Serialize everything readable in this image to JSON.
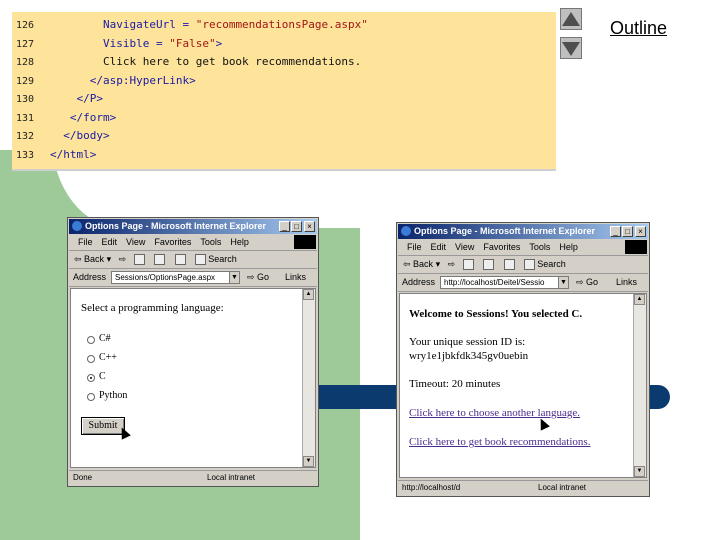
{
  "code": {
    "lines": [
      {
        "n": "126",
        "indent": "        ",
        "parts": [
          {
            "c": "kw",
            "t": "NavigateUrl = "
          },
          {
            "c": "str",
            "t": "\"recommendationsPage.aspx\""
          }
        ]
      },
      {
        "n": "127",
        "indent": "        ",
        "parts": [
          {
            "c": "kw",
            "t": "Visible = "
          },
          {
            "c": "str",
            "t": "\"False\""
          },
          {
            "c": "kw",
            "t": ">"
          }
        ]
      },
      {
        "n": "128",
        "indent": "        ",
        "parts": [
          {
            "c": "tx",
            "t": "Click here to get book recommendations."
          }
        ]
      },
      {
        "n": "129",
        "indent": "      ",
        "parts": [
          {
            "c": "kw",
            "t": "</asp:HyperLink>"
          }
        ]
      },
      {
        "n": "130",
        "indent": "    ",
        "parts": [
          {
            "c": "kw",
            "t": "</P>"
          }
        ]
      },
      {
        "n": "131",
        "indent": "   ",
        "parts": [
          {
            "c": "kw",
            "t": "</form>"
          }
        ]
      },
      {
        "n": "132",
        "indent": "  ",
        "parts": [
          {
            "c": "kw",
            "t": "</body>"
          }
        ]
      },
      {
        "n": "133",
        "indent": "",
        "parts": [
          {
            "c": "kw",
            "t": "</html>"
          }
        ]
      }
    ]
  },
  "nav": {
    "outline_label": "Outline"
  },
  "win1": {
    "title": "Options Page - Microsoft Internet Explorer",
    "menu": [
      "File",
      "Edit",
      "View",
      "Favorites",
      "Tools",
      "Help"
    ],
    "back_label": "Back",
    "search_label": "Search",
    "address_label": "Address",
    "address_value": "Sessions/OptionsPage.aspx",
    "go_label": "Go",
    "links_label": "Links",
    "prompt": "Select a programming language:",
    "options": [
      "C#",
      "C++",
      "C",
      "Python"
    ],
    "selected_index": 2,
    "submit_label": "Submit",
    "status_left": "Done",
    "status_right": "Local intranet"
  },
  "win2": {
    "title": "Options Page - Microsoft Internet Explorer",
    "menu": [
      "File",
      "Edit",
      "View",
      "Favorites",
      "Tools",
      "Help"
    ],
    "back_label": "Back",
    "search_label": "Search",
    "address_label": "Address",
    "address_value": "http://localhost/Deitel/Sessio",
    "go_label": "Go",
    "links_label": "Links",
    "welcome": "Welcome to Sessions! You selected C.",
    "session_label": "Your unique session ID is:",
    "session_id": "wry1e1jbkfdk345gv0uebin",
    "timeout": "Timeout: 20 minutes",
    "link_choose": "Click here to choose another language.",
    "link_books": "Click here to get book recommendations.",
    "status_left": "http://localhost/d",
    "status_right": "Local intranet"
  },
  "colors": {
    "code_bg": "#fde49a",
    "slide_green": "#9dca98",
    "slide_bar": "#0b3a6e",
    "keyword": "#1a1aa6",
    "string": "#a31515"
  }
}
